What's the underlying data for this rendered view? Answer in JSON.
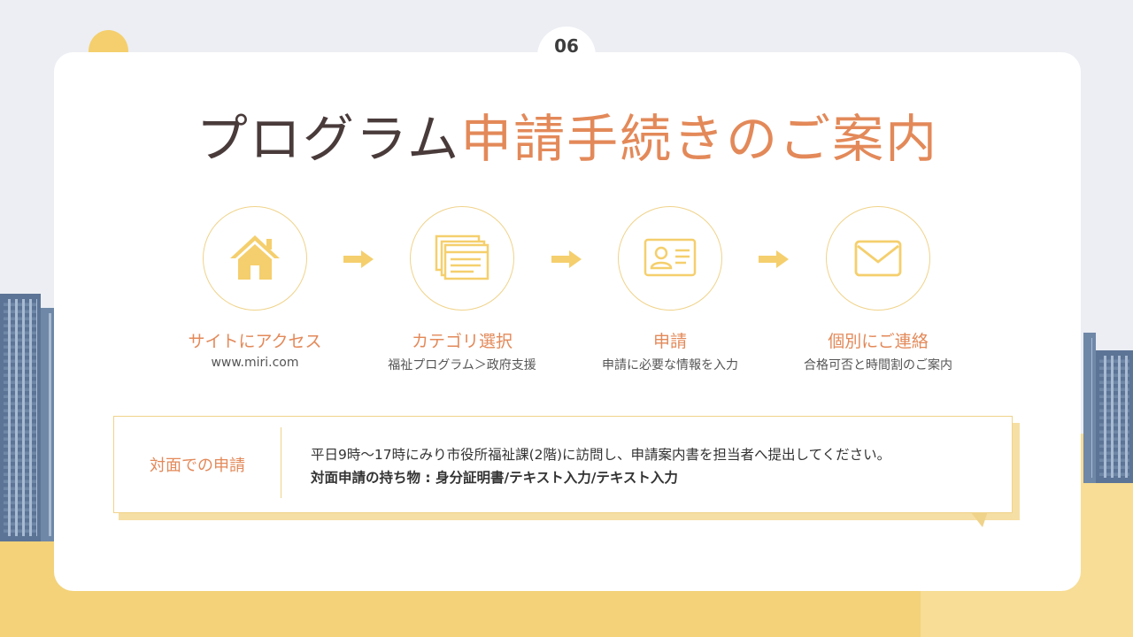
{
  "page_number": "06",
  "title": {
    "part1": "プログラム",
    "part2": "申請手続きのご案内"
  },
  "steps": [
    {
      "icon": "house-icon",
      "label": "サイトにアクセス",
      "sub": "www.miri.com"
    },
    {
      "icon": "browser-window-icon",
      "label": "カテゴリ選択",
      "sub": "福祉プログラム＞政府支援"
    },
    {
      "icon": "id-card-icon",
      "label": "申請",
      "sub": "申請に必要な情報を入力"
    },
    {
      "icon": "envelope-icon",
      "label": "個別にご連絡",
      "sub": "合格可否と時間割のご案内"
    }
  ],
  "info": {
    "label": "対面での申請",
    "line1": "平日9時〜17時にみり市役所福祉課(2階)に訪問し、申請案内書を担当者へ提出してください。",
    "line2": "対面申請の持ち物 : 身分証明書/テキスト入力/テキスト入力"
  },
  "colors": {
    "accent": "#e38959",
    "title_dark": "#4a3b3b",
    "icon_yellow": "#f5cf6d",
    "border_yellow": "#f0d38a",
    "ground": "#f3d27a"
  }
}
